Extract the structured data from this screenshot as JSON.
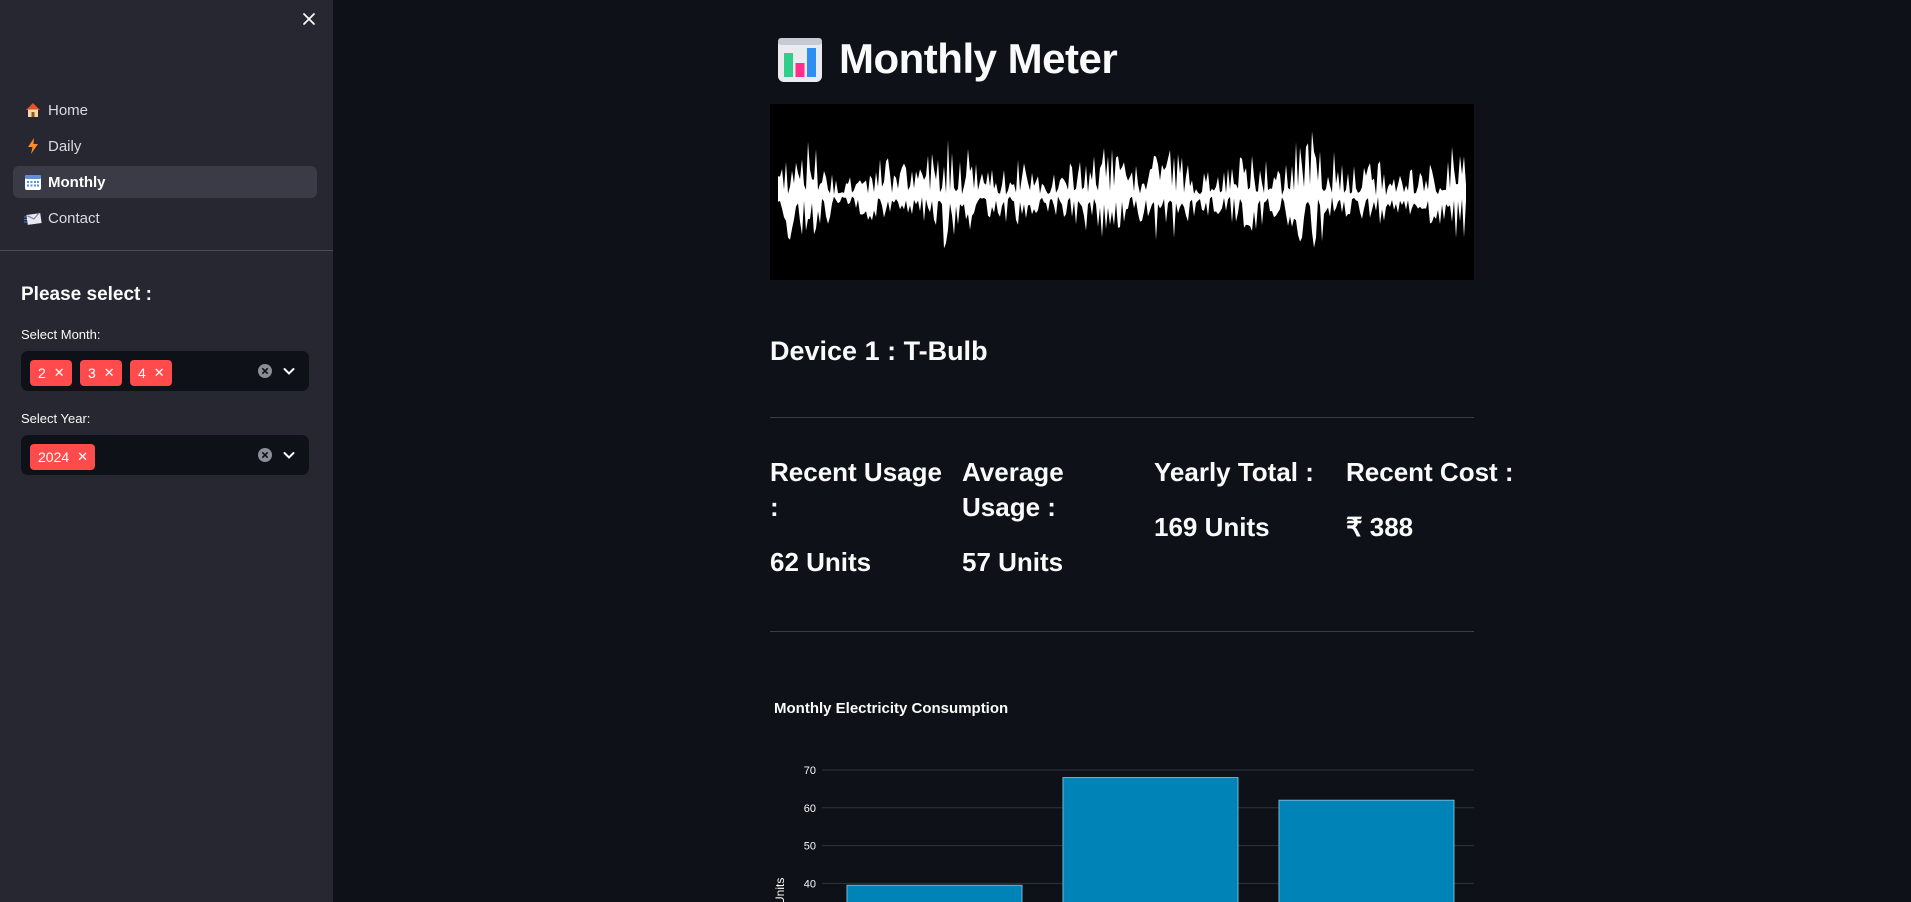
{
  "sidebar": {
    "nav": [
      {
        "label": "Home",
        "icon": "house-icon"
      },
      {
        "label": "Daily",
        "icon": "lightning-icon"
      },
      {
        "label": "Monthly",
        "icon": "calendar-icon",
        "active": true
      },
      {
        "label": "Contact",
        "icon": "envelope-icon"
      }
    ],
    "please_select": "Please select :",
    "month_label": "Select Month:",
    "months": [
      "2",
      "3",
      "4"
    ],
    "year_label": "Select Year:",
    "years": [
      "2024"
    ]
  },
  "main": {
    "title": "Monthly Meter",
    "device": "Device 1 : T-Bulb",
    "metrics": [
      {
        "label": "Recent Usage :",
        "value": "62 Units"
      },
      {
        "label": "Average Usage :",
        "value": "57 Units"
      },
      {
        "label": "Yearly Total :",
        "value": "169 Units"
      },
      {
        "label": "Recent Cost :",
        "value": "₹ 388"
      }
    ]
  },
  "chart_data": {
    "type": "bar",
    "title": "Monthly Electricity Consumption",
    "ylabel": "Units",
    "yticks": [
      "70",
      "60",
      "50",
      "40"
    ],
    "values": [
      39.5,
      68,
      62
    ],
    "color": "#0084b8",
    "ylim": [
      30,
      70
    ]
  },
  "colors": {
    "accent": "#ff4b4b",
    "sidebar_bg": "#262730",
    "main_bg": "#0e1117"
  }
}
